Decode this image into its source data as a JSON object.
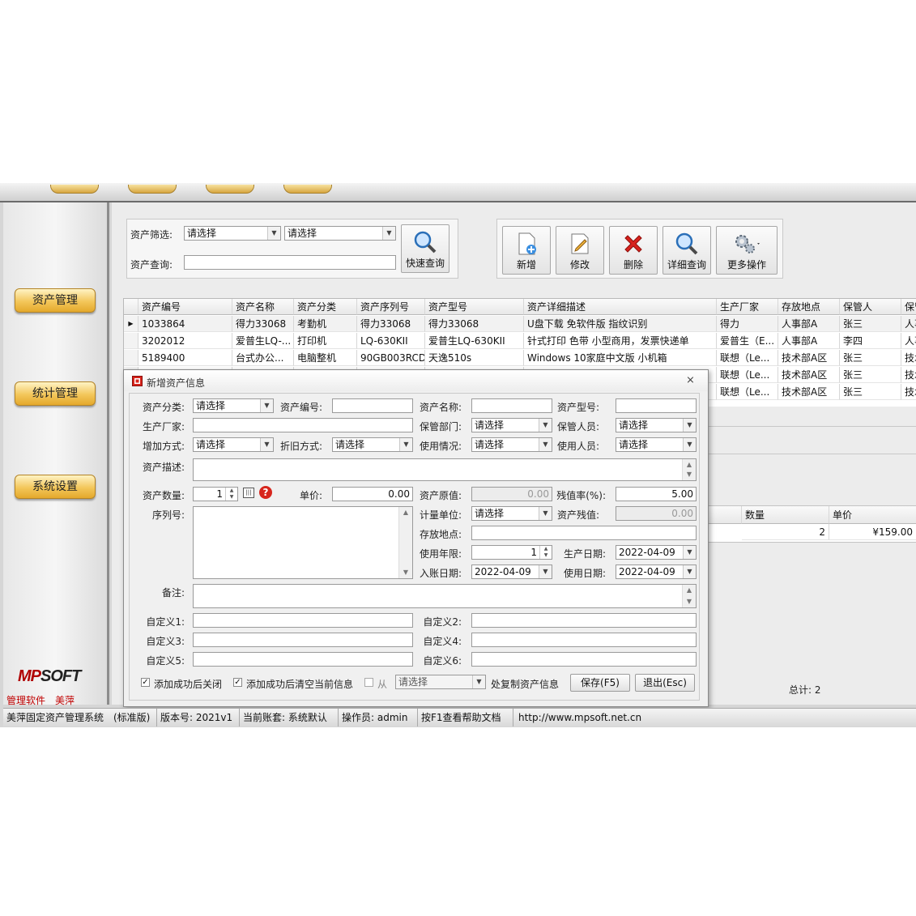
{
  "sidebar": {
    "nav": [
      {
        "label": "资产管理"
      },
      {
        "label": "统计管理"
      },
      {
        "label": "系统设置"
      }
    ],
    "logo_mp": "MP",
    "logo_soft": "SOFT",
    "tagline": "管理软件　美萍"
  },
  "filter": {
    "filter_label": "资产筛选:",
    "query_label": "资产查询:",
    "filter1_value": "请选择",
    "filter2_value": "请选择",
    "query_value": "",
    "quick_query_label": "快速查询"
  },
  "toolbar": {
    "add": "新增",
    "edit": "修改",
    "delete": "删除",
    "detail": "详细查询",
    "more": "更多操作"
  },
  "grid": {
    "columns": [
      "资产编号",
      "资产名称",
      "资产分类",
      "资产序列号",
      "资产型号",
      "资产详细描述",
      "生产厂家",
      "存放地点",
      "保管人",
      "保管部"
    ],
    "rows": [
      [
        "1033864",
        "得力33068",
        "考勤机",
        "得力33068",
        "得力33068",
        "U盘下载 免软件版 指纹识别",
        "得力",
        "人事部A",
        "张三",
        "人事部"
      ],
      [
        "3202012",
        "爱普生LQ-...",
        "打印机",
        "LQ-630KII",
        "爱普生LQ-630KII",
        "针式打印 色带 小型商用，发票快递单",
        "爱普生（E...",
        "人事部A",
        "李四",
        "人事部"
      ],
      [
        "5189400",
        "台式办公...",
        "电脑整机",
        "90GB003RCD",
        "天逸510s",
        "Windows 10家庭中文版 小机箱",
        "联想（Le...",
        "技术部A区",
        "张三",
        "技术部"
      ],
      [
        "",
        "",
        "",
        "",
        "",
        "",
        "联想（Le...",
        "技术部A区",
        "张三",
        "技术部"
      ],
      [
        "",
        "",
        "",
        "",
        "",
        "",
        "联想（Le...",
        "技术部A区",
        "张三",
        "技术部"
      ]
    ]
  },
  "lower": {
    "qty_header": "数量",
    "price_header": "单价",
    "qty_value": "2",
    "price_value": "¥159.00",
    "total": "总计: 2"
  },
  "dialog": {
    "title": "新增资产信息",
    "labels": {
      "category": "资产分类:",
      "code": "资产编号:",
      "name": "资产名称:",
      "model": "资产型号:",
      "maker": "生产厂家:",
      "dept": "保管部门:",
      "keeper": "保管人员:",
      "add_method": "增加方式:",
      "depr": "折旧方式:",
      "usage": "使用情况:",
      "user": "使用人员:",
      "desc": "资产描述:",
      "qty": "资产数量:",
      "price": "单价:",
      "orig": "资产原值:",
      "residual_rate": "残值率(%):",
      "serial": "序列号:",
      "unit": "计量单位:",
      "residual": "资产残值:",
      "location": "存放地点:",
      "years": "使用年限:",
      "prod_date": "生产日期:",
      "book_date": "入账日期:",
      "use_date": "使用日期:",
      "remark": "备注:",
      "c1": "自定义1:",
      "c2": "自定义2:",
      "c3": "自定义3:",
      "c4": "自定义4:",
      "c5": "自定义5:",
      "c6": "自定义6:"
    },
    "values": {
      "select": "请选择",
      "qty": "1",
      "price": "0.00",
      "orig": "0.00",
      "residual_rate": "5.00",
      "residual": "0.00",
      "years": "1",
      "prod_date": "2022-04-09",
      "book_date": "2022-04-09",
      "use_date": "2022-04-09"
    },
    "footer": {
      "close_after": "添加成功后关闭",
      "clear_after": "添加成功后清空当前信息",
      "from": "从",
      "from_value": "请选择",
      "copy": "处复制资产信息",
      "save": "保存(F5)",
      "exit": "退出(Esc)"
    }
  },
  "status": {
    "app": "美萍固定资产管理系统　(标准版)",
    "version": "版本号: 2021v1",
    "account": "当前账套: 系统默认",
    "operator": "操作员: admin",
    "help": "按F1查看帮助文档",
    "url": "http://www.mpsoft.net.cn"
  }
}
